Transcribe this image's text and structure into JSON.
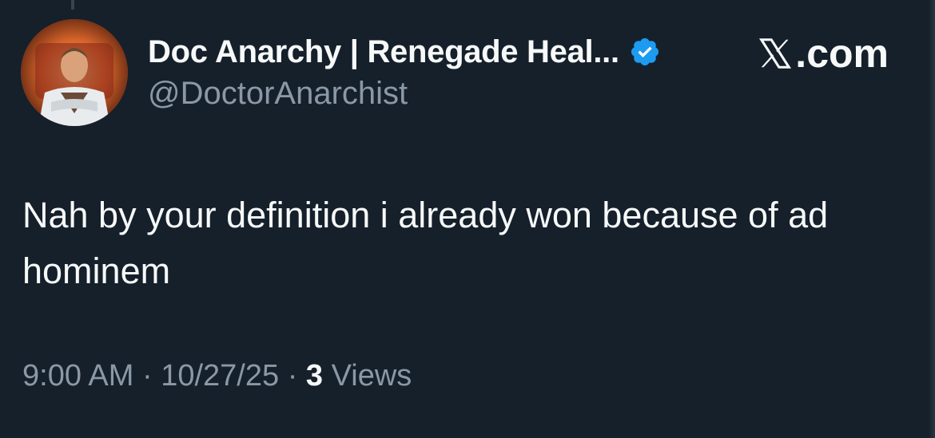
{
  "tweet": {
    "display_name": "Doc Anarchy | Renegade Heal...",
    "handle": "@DoctorAnarchist",
    "verified": true,
    "text": "Nah by your definition i already won because of ad hominem",
    "time": "9:00 AM",
    "date": "10/27/25",
    "separator": "·",
    "views_count": "3",
    "views_label": "Views"
  },
  "brand": {
    "icon": "x-logo-icon",
    "label": ".com"
  },
  "colors": {
    "background": "#15202b",
    "primary_text": "#f7f9f9",
    "secondary_text": "#8b98a5",
    "verified_blue": "#1d9bf0"
  }
}
